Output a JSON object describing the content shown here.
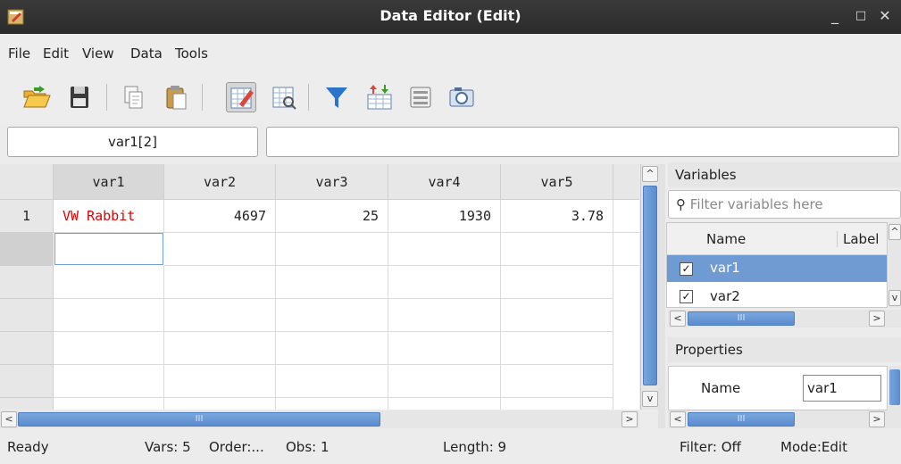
{
  "window": {
    "title": "Data Editor (Edit)",
    "minimize": "_",
    "maximize": "□",
    "close": "✕"
  },
  "menu": [
    "File",
    "Edit",
    "View",
    "Data",
    "Tools"
  ],
  "toolbar": [
    {
      "name": "open-icon"
    },
    {
      "name": "save-icon"
    },
    {
      "name": "copy-icon"
    },
    {
      "name": "paste-icon"
    },
    {
      "name": "edit-mode-icon"
    },
    {
      "name": "browse-mode-icon"
    },
    {
      "name": "filter-icon"
    },
    {
      "name": "variable-manager-icon"
    },
    {
      "name": "properties-icon"
    },
    {
      "name": "snapshot-icon"
    }
  ],
  "cellname": "var1[2]",
  "cellvalue": "",
  "grid": {
    "columns": [
      "var1",
      "var2",
      "var3",
      "var4",
      "var5"
    ],
    "rows": [
      {
        "num": "1",
        "cells": [
          "VW Rabbit",
          "4697",
          "25",
          "1930",
          "3.78"
        ]
      }
    ]
  },
  "variables": {
    "header": "Variables",
    "filter_placeholder": "Filter variables here",
    "col_name": "Name",
    "col_label": "Label",
    "items": [
      {
        "name": "var1",
        "checked": true,
        "selected": true
      },
      {
        "name": "var2",
        "checked": true,
        "selected": false
      }
    ]
  },
  "properties": {
    "header": "Properties",
    "name_label": "Name",
    "name_value": "var1"
  },
  "scroll_grip": "III",
  "status": {
    "ready": "Ready",
    "vars": "Vars: 5",
    "order": "Order:...",
    "obs": "Obs: 1",
    "length": "Length: 9",
    "filter": "Filter: Off",
    "mode": "Mode:Edit"
  }
}
